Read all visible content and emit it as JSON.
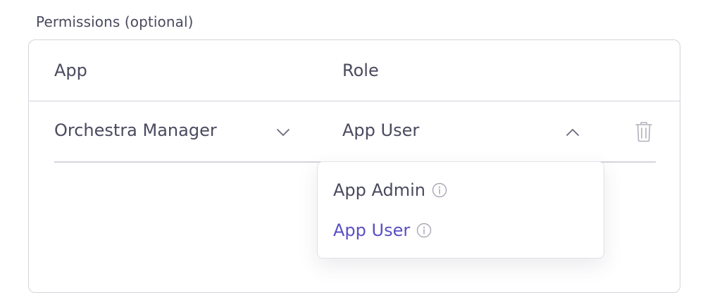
{
  "section_label": "Permissions (optional)",
  "table": {
    "headers": {
      "app": "App",
      "role": "Role"
    },
    "rows": [
      {
        "app": "Orchestra Manager",
        "role": "App User"
      }
    ]
  },
  "role_dropdown": {
    "options": [
      {
        "label": "App Admin",
        "selected": false
      },
      {
        "label": "App User",
        "selected": true
      }
    ]
  },
  "colors": {
    "text": "#4a4a5e",
    "accent": "#5a4fc4",
    "border": "#d4d4dc",
    "icon": "#9a9aa8"
  }
}
